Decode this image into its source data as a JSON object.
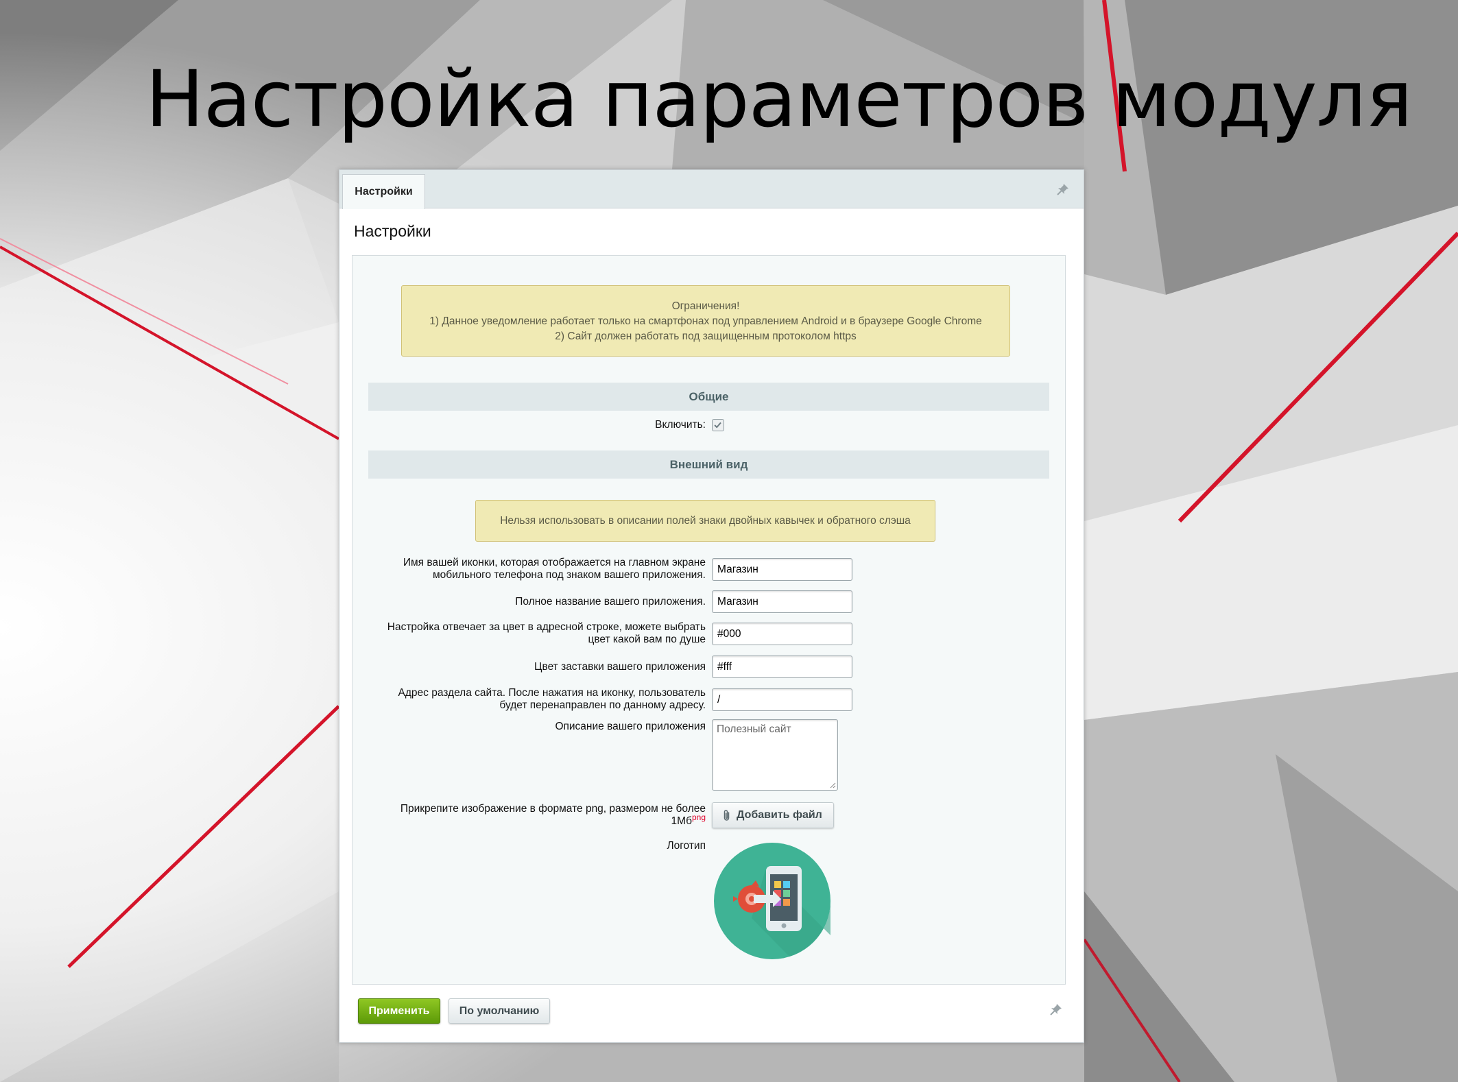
{
  "slide": {
    "title": "Настройка параметров модуля"
  },
  "panel": {
    "tab_label": "Настройки",
    "heading": "Настройки",
    "notice_restrictions": {
      "title": "Ограничения!",
      "line1": "1) Данное уведомление работает только на смартфонах под управлением Android и в браузере Google Chrome",
      "line2": "2) Сайт должен работать под защищенным протоколом https"
    },
    "section_general": "Общие",
    "enable_label": "Включить:",
    "enable_checked": true,
    "section_appearance": "Внешний вид",
    "notice_quotes": "Нельзя использовать в описании полей знаки двойных кавычек и обратного слэша",
    "fields": {
      "icon_name": {
        "label_line1": "Имя вашей иконки, которая отображается на главном экране",
        "label_line2": "мобильного телефона под знаком вашего приложения.",
        "value": "Магазин"
      },
      "app_name": {
        "label": "Полное название вашего приложения.",
        "value": "Магазин"
      },
      "address_bar_color": {
        "label_line1": "Настройка отвечает за цвет в адресной строке, можете выбрать",
        "label_line2": "цвет какой вам по душе",
        "value": "#000"
      },
      "splash_color": {
        "label": "Цвет заставки вашего приложения",
        "value": "#fff"
      },
      "section_url": {
        "label_line1": "Адрес раздела сайта. После нажатия на иконку, пользователь",
        "label_line2": "будет перенаправлен по данному адресу.",
        "value": "/"
      },
      "description": {
        "label": "Описание вашего приложения",
        "placeholder": "Полезный сайт"
      },
      "image": {
        "label_line1": "Прикрепите изображение в формате png, размером не более",
        "label_line2": "1Мб",
        "label_sup": "png",
        "button_label": "Добавить файл"
      },
      "logo": {
        "label": "Логотип"
      }
    },
    "buttons": {
      "apply": "Применить",
      "default": "По умолчанию"
    }
  },
  "colors": {
    "apply_button": "#6aa913",
    "notice_bg": "#f0eab4",
    "section_bg": "#e0e8ea",
    "logo_circle": "#3fb395",
    "accent_red": "#e0002a"
  },
  "icons": [
    "pin-icon",
    "checkbox-check-icon",
    "paperclip-icon",
    "app-logo-icon"
  ]
}
